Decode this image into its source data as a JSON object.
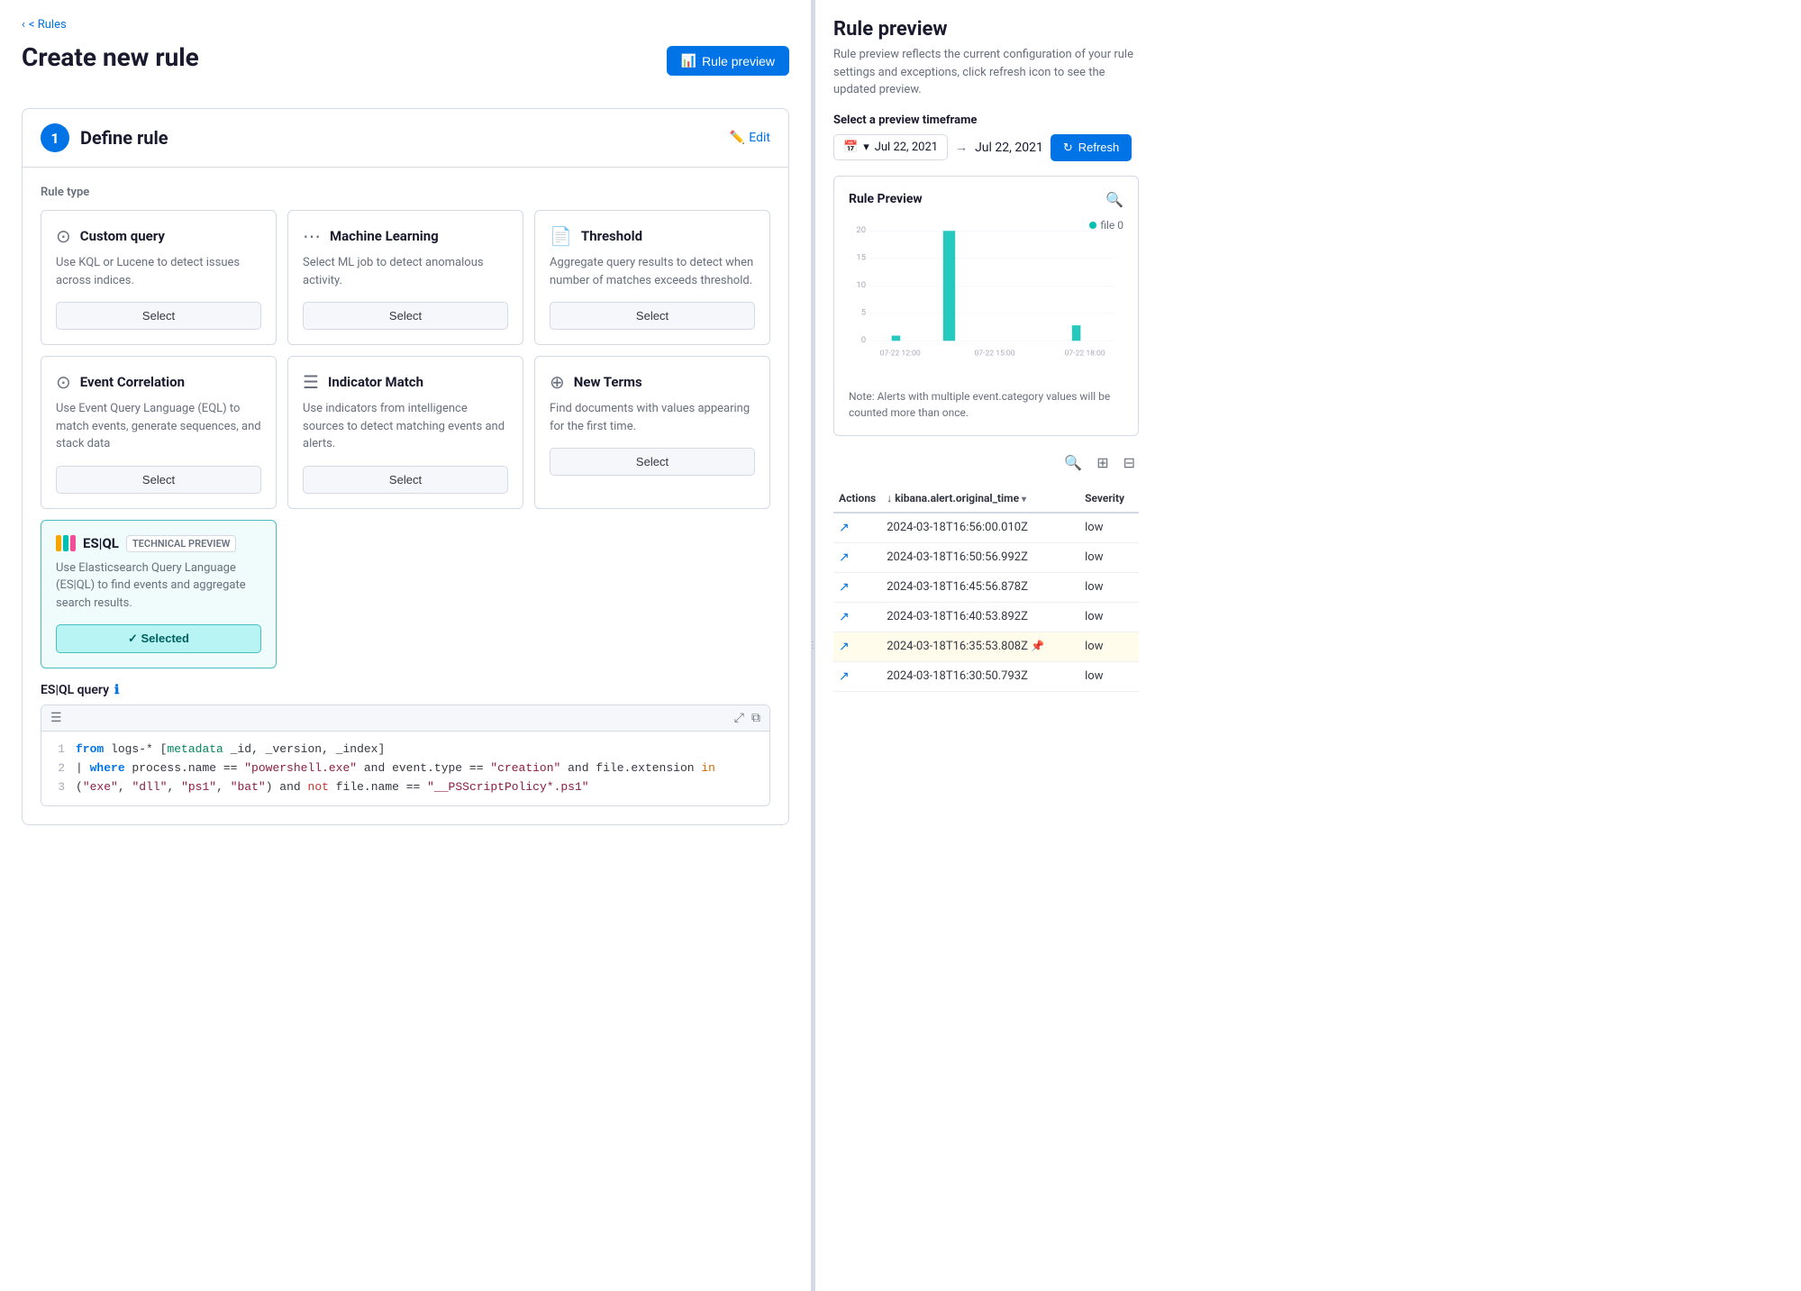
{
  "breadcrumb": {
    "label": "< Rules"
  },
  "page": {
    "title": "Create new rule",
    "rule_preview_button": "Rule preview",
    "rule_preview_icon": "📊"
  },
  "define_rule_section": {
    "step_number": "1",
    "title": "Define rule",
    "edit_label": "Edit",
    "rule_type_label": "Rule type",
    "rule_cards": [
      {
        "id": "custom_query",
        "title": "Custom query",
        "description": "Use KQL or Lucene to detect issues across indices.",
        "select_label": "Select",
        "icon": "⊙",
        "selected": false
      },
      {
        "id": "machine_learning",
        "title": "Machine Learning",
        "description": "Select ML job to detect anomalous activity.",
        "select_label": "Select",
        "icon": "⋯",
        "selected": false
      },
      {
        "id": "threshold",
        "title": "Threshold",
        "description": "Aggregate query results to detect when number of matches exceeds threshold.",
        "select_label": "Select",
        "icon": "📄",
        "selected": false
      },
      {
        "id": "event_correlation",
        "title": "Event Correlation",
        "description": "Use Event Query Language (EQL) to match events, generate sequences, and stack data",
        "select_label": "Select",
        "icon": "⊙",
        "selected": false
      },
      {
        "id": "indicator_match",
        "title": "Indicator Match",
        "description": "Use indicators from intelligence sources to detect matching events and alerts.",
        "select_label": "Select",
        "icon": "☰",
        "selected": false
      },
      {
        "id": "new_terms",
        "title": "New Terms",
        "description": "Find documents with values appearing for the first time.",
        "select_label": "Select",
        "icon": "⊕",
        "selected": false
      }
    ],
    "esql_card": {
      "title": "ES|QL",
      "tech_preview_label": "TECHNICAL PREVIEW",
      "description": "Use Elasticsearch Query Language (ES|QL) to find events and aggregate search results.",
      "selected_label": "Selected",
      "selected": true
    },
    "esql_query_label": "ES|QL query",
    "code_lines": [
      {
        "num": "1",
        "text": "from logs-* [metadata _id, _version, _index]"
      },
      {
        "num": "2",
        "text": "| where process.name == \"powershell.exe\" and event.type == \"creation\" and file.extension in"
      },
      {
        "num": "3",
        "text": "(\"exe\", \"dll\", \"ps1\", \"bat\") and not file.name == \"__PSScriptPolicy*.ps1\""
      }
    ]
  },
  "right_panel": {
    "title": "Rule preview",
    "description": "Rule preview reflects the current configuration of your rule settings and exceptions, click refresh icon to see the updated preview.",
    "timeframe_label": "Select a preview timeframe",
    "date_from": "Jul 22, 2021",
    "date_to": "Jul 22, 2021",
    "refresh_button": "Refresh",
    "chart": {
      "title": "Rule Preview",
      "legend_label": "file  0",
      "y_labels": [
        "20",
        "15",
        "10",
        "5",
        "0"
      ],
      "x_labels": [
        "07-22 12:00",
        "07-22 15:00",
        "07-22 18:00"
      ],
      "note": "Note: Alerts with multiple event.category values will be counted more than once."
    },
    "table": {
      "columns": [
        "Actions",
        "kibana.alert.original_time",
        "Severity"
      ],
      "rows": [
        {
          "time": "2024-03-18T16:56:00.010Z",
          "severity": "low",
          "highlighted": false
        },
        {
          "time": "2024-03-18T16:50:56.992Z",
          "severity": "low",
          "highlighted": false
        },
        {
          "time": "2024-03-18T16:45:56.878Z",
          "severity": "low",
          "highlighted": false
        },
        {
          "time": "2024-03-18T16:40:53.892Z",
          "severity": "low",
          "highlighted": false
        },
        {
          "time": "2024-03-18T16:35:53.808Z",
          "severity": "low",
          "highlighted": true
        },
        {
          "time": "2024-03-18T16:30:50.793Z",
          "severity": "low",
          "highlighted": false
        }
      ]
    }
  }
}
